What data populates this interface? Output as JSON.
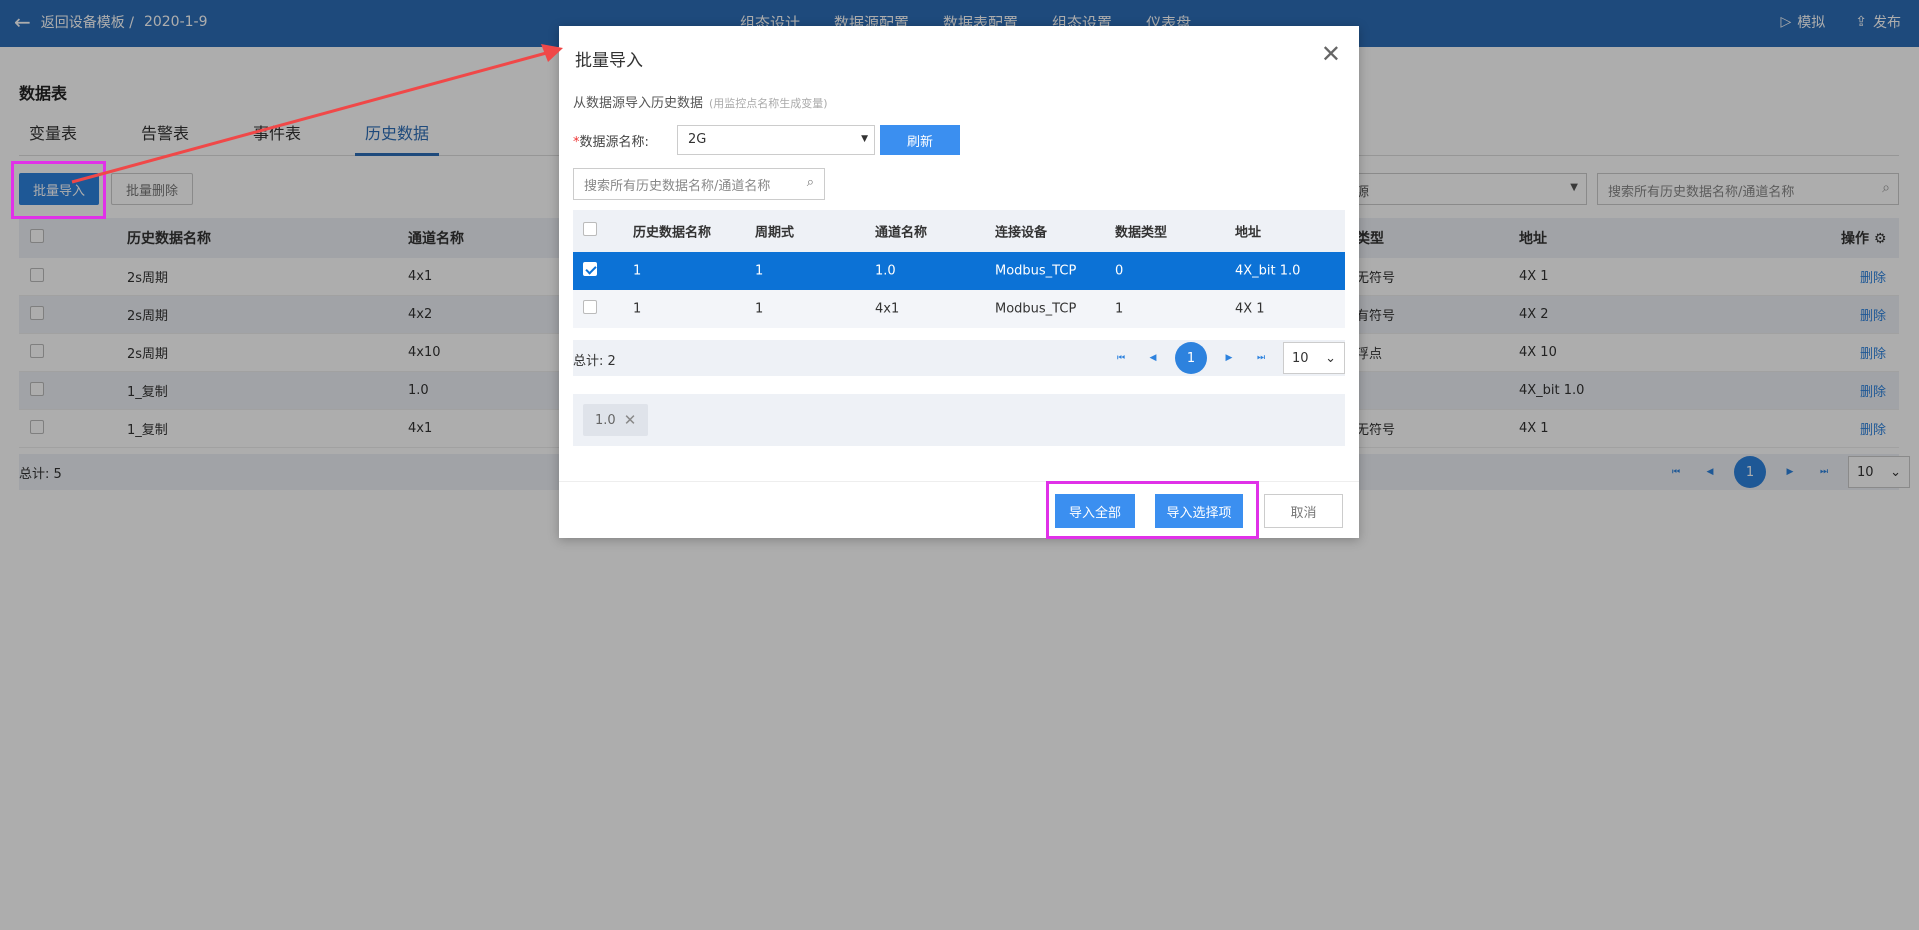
{
  "topbar": {
    "back_label": "返回设备模板 /",
    "date": "2020-1-9",
    "nav": [
      "组态设计",
      "数据源配置",
      "数据表配置",
      "组态设置",
      "仪表盘"
    ],
    "simulate": "模拟",
    "publish": "发布"
  },
  "page": {
    "title": "数据表",
    "tabs": [
      "变量表",
      "告警表",
      "事件表",
      "历史数据"
    ],
    "active_tab": "历史数据",
    "batch_import": "批量导入",
    "batch_delete": "批量删除",
    "filter_select": "源",
    "search_placeholder": "搜索所有历史数据名称/通道名称",
    "columns": {
      "name": "历史数据名称",
      "channel": "通道名称",
      "type": "类型",
      "address": "地址",
      "ops": "操作"
    },
    "rows": [
      {
        "name": "2s周期",
        "channel": "4x1",
        "type": "无符号",
        "address": "4X 1",
        "op": "删除"
      },
      {
        "name": "2s周期",
        "channel": "4x2",
        "type": "有符号",
        "address": "4X 2",
        "op": "删除"
      },
      {
        "name": "2s周期",
        "channel": "4x10",
        "type": "浮点",
        "address": "4X 10",
        "op": "删除"
      },
      {
        "name": "1_复制",
        "channel": "1.0",
        "type": "",
        "address": "4X_bit 1.0",
        "op": "删除"
      },
      {
        "name": "1_复制",
        "channel": "4x1",
        "type": "无符号",
        "address": "4X 1",
        "op": "删除"
      }
    ],
    "total": "总计: 5",
    "page_current": "1",
    "page_size": "10"
  },
  "modal": {
    "title": "批量导入",
    "subtitle": "从数据源导入历史数据",
    "hint": "(用监控点名称生成变量)",
    "required_mark": "*",
    "ds_label": "数据源名称:",
    "ds_value": "2G",
    "refresh": "刷新",
    "search_placeholder": "搜索所有历史数据名称/通道名称",
    "columns": [
      "历史数据名称",
      "周期式",
      "通道名称",
      "连接设备",
      "数据类型",
      "地址"
    ],
    "rows": [
      {
        "name": "1",
        "period": "1",
        "channel": "1.0",
        "device": "Modbus_TCP",
        "dtype": "0",
        "address": "4X_bit 1.0",
        "selected": true
      },
      {
        "name": "1",
        "period": "1",
        "channel": "4x1",
        "device": "Modbus_TCP",
        "dtype": "1",
        "address": "4X 1",
        "selected": false
      }
    ],
    "total": "总计: 2",
    "page_current": "1",
    "page_size": "10",
    "selected_tag": "1.0",
    "import_all": "导入全部",
    "import_selected": "导入选择项",
    "cancel": "取消"
  },
  "colors": {
    "topbar": "#2d6eb7",
    "primary": "#2d82de",
    "selected_row": "#0c72d6",
    "highlight_box": "#e031e8",
    "annotation_arrow": "#f04848"
  }
}
